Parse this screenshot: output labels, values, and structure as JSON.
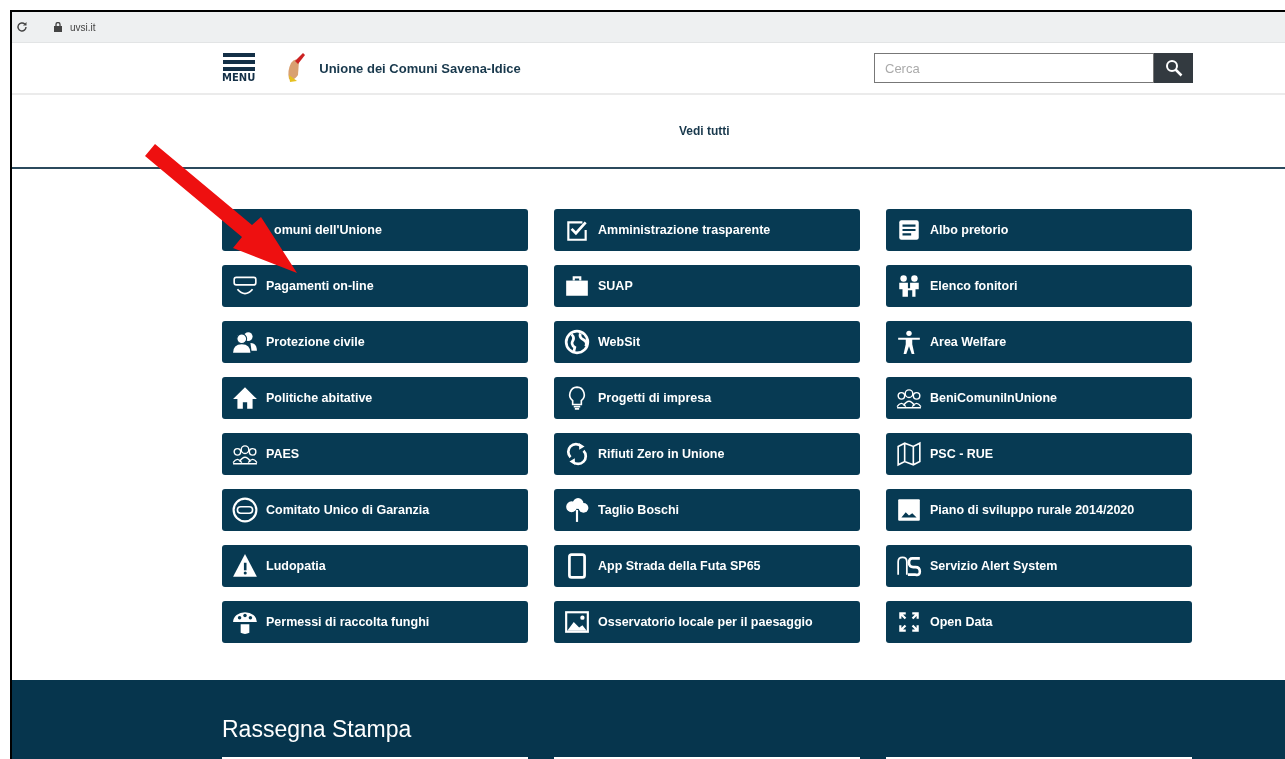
{
  "browser": {
    "url": "uvsi.it"
  },
  "header": {
    "menu_label": "MENU",
    "site_title": "Unione dei Comuni Savena-Idice",
    "search": {
      "placeholder": "Cerca"
    }
  },
  "see_all": "Vedi tutti",
  "tiles": [
    {
      "label": "omuni dell'Unione",
      "kind": "none"
    },
    {
      "label": "Amministrazione trasparente",
      "kind": "checkbox"
    },
    {
      "label": "Albo pretorio",
      "kind": "document"
    },
    {
      "label": "Pagamenti on-line",
      "kind": "arc"
    },
    {
      "label": "SUAP",
      "kind": "briefcase"
    },
    {
      "label": "Elenco fonitori",
      "kind": "pair"
    },
    {
      "label": "Protezione civile",
      "kind": "group"
    },
    {
      "label": "WebSit",
      "kind": "globe"
    },
    {
      "label": "Area Welfare",
      "kind": "person"
    },
    {
      "label": "Politiche abitative",
      "kind": "house"
    },
    {
      "label": "Progetti di impresa",
      "kind": "bulb"
    },
    {
      "label": "BeniComuniInUnione",
      "kind": "community"
    },
    {
      "label": "PAES",
      "kind": "community"
    },
    {
      "label": "Rifiuti Zero in Unione",
      "kind": "refresh"
    },
    {
      "label": "PSC - RUE",
      "kind": "map"
    },
    {
      "label": "Comitato Unico di Garanzia",
      "kind": "badge"
    },
    {
      "label": "Taglio Boschi",
      "kind": "tree"
    },
    {
      "label": "Piano di sviluppo rurale 2014/2020",
      "kind": "photo"
    },
    {
      "label": "Ludopatia",
      "kind": "warning"
    },
    {
      "label": "App Strada della Futa SP65",
      "kind": "tablet"
    },
    {
      "label": "Servizio Alert System",
      "kind": "alert"
    },
    {
      "label": "Permessi di raccolta funghi",
      "kind": "mushroom"
    },
    {
      "label": "Osservatorio locale per il paesaggio",
      "kind": "landscape"
    },
    {
      "label": "Open Data",
      "kind": "expand"
    }
  ],
  "press": {
    "title": "Rassegna Stampa"
  }
}
